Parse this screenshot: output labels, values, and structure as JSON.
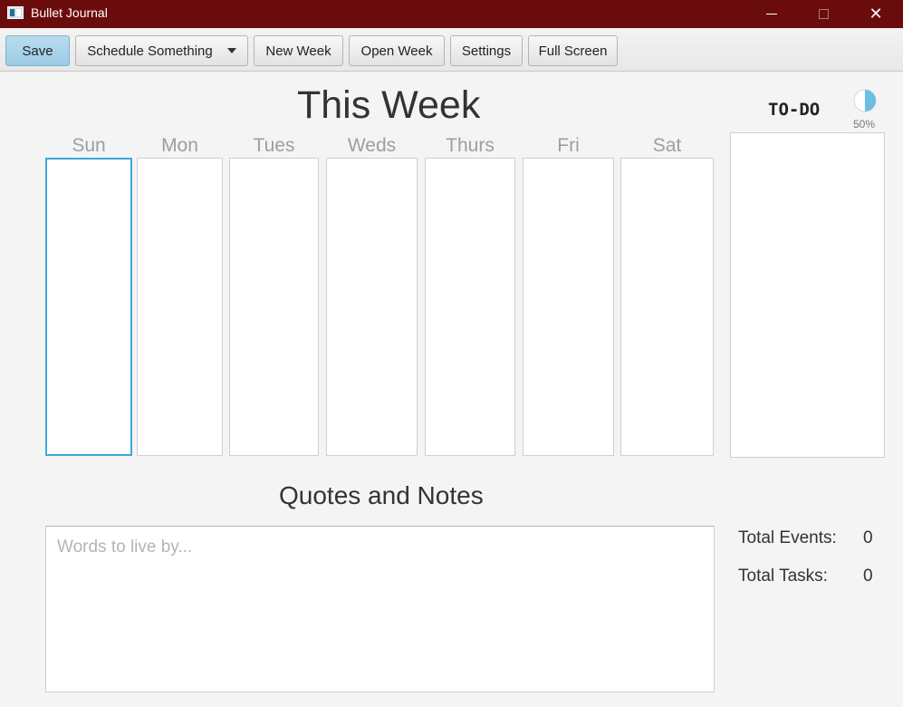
{
  "window": {
    "title": "Bullet Journal",
    "close_glyph": "✕"
  },
  "toolbar": {
    "save_label": "Save",
    "schedule_label": "Schedule Something",
    "new_week_label": "New Week",
    "open_week_label": "Open Week",
    "settings_label": "Settings",
    "full_screen_label": "Full Screen"
  },
  "week": {
    "title": "This Week",
    "days": [
      "Sun",
      "Mon",
      "Tues",
      "Weds",
      "Thurs",
      "Fri",
      "Sat"
    ]
  },
  "todo": {
    "label": "TO-DO",
    "progress": 0.5,
    "progress_text": "50%",
    "progress_color": "#6bbfe0"
  },
  "notes": {
    "title": "Quotes and Notes",
    "placeholder": "Words to live by..."
  },
  "stats": {
    "events_label": "Total Events:",
    "events_value": "0",
    "tasks_label": "Total Tasks:",
    "tasks_value": "0"
  },
  "colors": {
    "titlebar": "#6b0c0c",
    "active_border": "#3aaad9",
    "save_button": "#a9d3ea"
  }
}
